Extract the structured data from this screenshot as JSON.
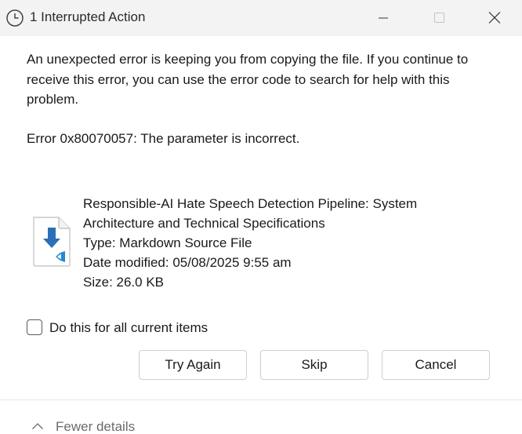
{
  "window": {
    "title": "1 Interrupted Action",
    "title_icon": "clock-icon",
    "minimize_icon": "minimize-icon",
    "maximize_icon": "maximize-icon",
    "close_icon": "close-icon"
  },
  "message": {
    "body": "An unexpected error is keeping you from copying the file. If you continue to receive this error, you can use the error code to search for help with this problem.",
    "error": "Error 0x80070057: The parameter is incorrect."
  },
  "file": {
    "icon": "markdown-vscode-file-icon",
    "name": "Responsible-AI Hate Speech Detection Pipeline: System Architecture and Technical Specifications",
    "type": "Type: Markdown Source File",
    "modified": "Date modified: 05/08/2025 9:55 am",
    "size": "Size: 26.0 KB"
  },
  "checkbox": {
    "label": "Do this for all current items",
    "checked": false
  },
  "buttons": {
    "try_again": "Try Again",
    "skip": "Skip",
    "cancel": "Cancel"
  },
  "footer": {
    "toggle_label": "Fewer details",
    "toggle_icon": "chevron-up-icon"
  },
  "colors": {
    "titlebar_bg": "#f3f3f3",
    "file_arrow": "#2b6fb8",
    "vscode_badge": "#1f8ad2"
  }
}
